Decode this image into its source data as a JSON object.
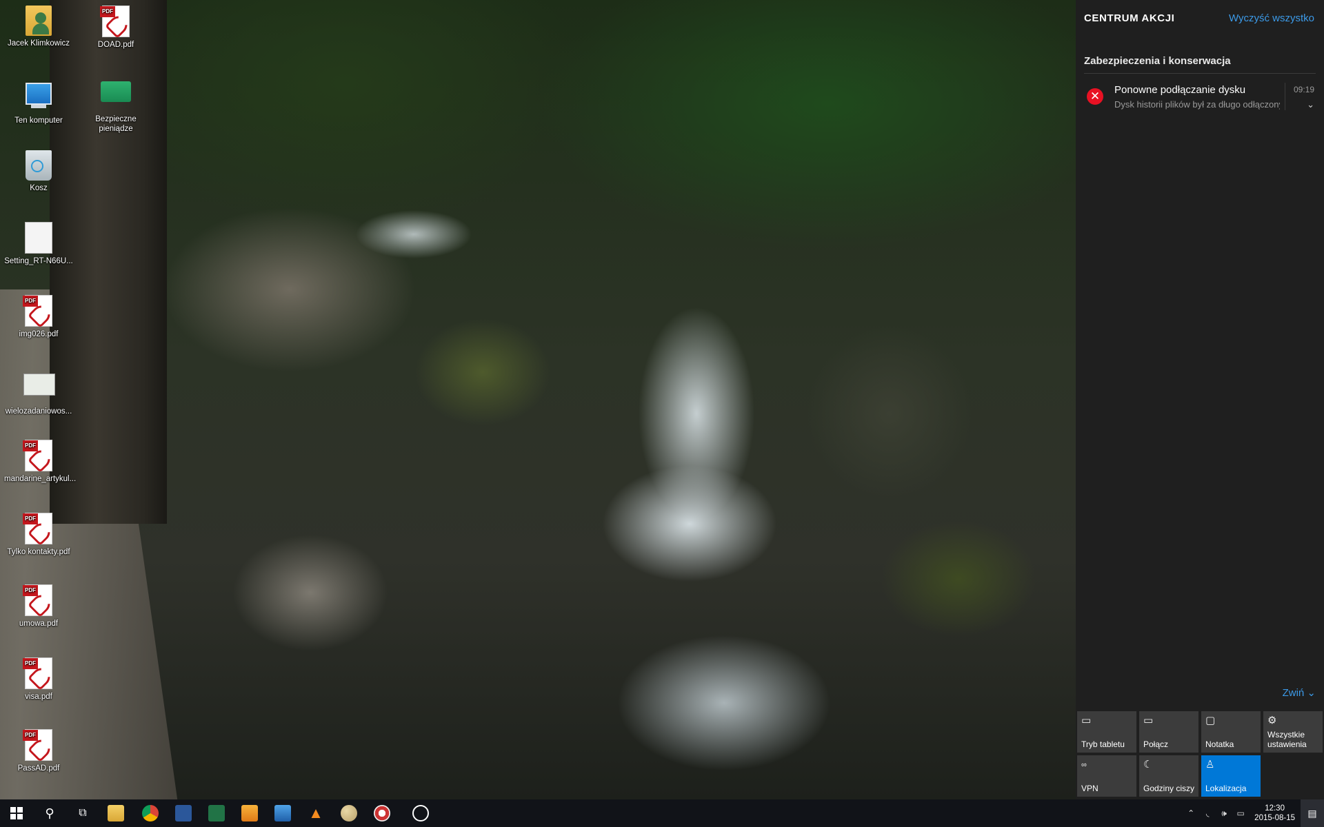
{
  "desktop": {
    "icons": [
      {
        "label": "Jacek Klimkowicz",
        "type": "user-folder"
      },
      {
        "label": "DOAD.pdf",
        "type": "pdf"
      },
      {
        "label": "Ten komputer",
        "type": "computer"
      },
      {
        "label": "Bezpieczne pieniądze",
        "type": "shortcut"
      },
      {
        "label": "Kosz",
        "type": "recycle-bin"
      },
      {
        "label": "Setting_RT-N66U...",
        "type": "file"
      },
      {
        "label": "img026.pdf",
        "type": "pdf"
      },
      {
        "label": "wielozadaniowos...",
        "type": "image"
      },
      {
        "label": "mandarine_artykul...",
        "type": "pdf"
      },
      {
        "label": "Tylko kontakty.pdf",
        "type": "pdf"
      },
      {
        "label": "umowa.pdf",
        "type": "pdf"
      },
      {
        "label": "visa.pdf",
        "type": "pdf"
      },
      {
        "label": "PassAD.pdf",
        "type": "pdf"
      }
    ],
    "pdf_tag": "PDF"
  },
  "action_center": {
    "title": "CENTRUM AKCJI",
    "clear_all": "Wyczyść wszystko",
    "group_title": "Zabezpieczenia i konserwacja",
    "notification": {
      "title": "Ponowne podłączanie dysku",
      "body": "Dysk historii plików był za długo odłączony",
      "time": "09:19",
      "icon": "error-icon"
    },
    "collapse": "Zwiń",
    "quick_actions": [
      {
        "label": "Tryb tabletu",
        "icon": "tablet-mode-icon",
        "active": false
      },
      {
        "label": "Połącz",
        "icon": "connect-icon",
        "active": false
      },
      {
        "label": "Notatka",
        "icon": "note-icon",
        "active": false
      },
      {
        "label": "Wszystkie ustawienia",
        "icon": "gear-icon",
        "active": false
      },
      {
        "label": "VPN",
        "icon": "vpn-icon",
        "active": false
      },
      {
        "label": "Godziny ciszy",
        "icon": "moon-icon",
        "active": false
      },
      {
        "label": "Lokalizacja",
        "icon": "location-icon",
        "active": true
      }
    ],
    "accent_color": "#0078d7",
    "link_color": "#3c9ae8"
  },
  "taskbar": {
    "clock_time": "12:30",
    "clock_date": "2015-08-15",
    "apps": [
      "start",
      "search",
      "task-view",
      "file-explorer",
      "chrome",
      "word",
      "excel",
      "media-player",
      "remote-desktop",
      "vlc",
      "paint",
      "app",
      "xbox"
    ]
  }
}
